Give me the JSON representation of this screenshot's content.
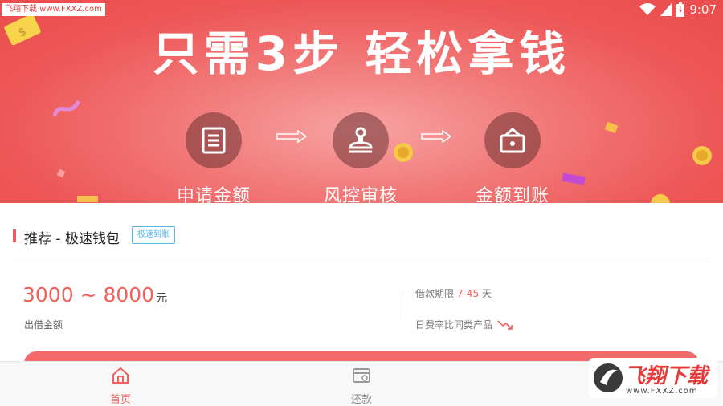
{
  "statusbar": {
    "watermark": "飞翔下载 www.FXXZ.com",
    "time": "9:07"
  },
  "banner": {
    "headline": "只需3步 轻松拿钱",
    "steps": [
      {
        "label": "申请金额",
        "icon": "document-icon"
      },
      {
        "label": "风控审核",
        "icon": "stamp-icon"
      },
      {
        "label": "金额到账",
        "icon": "wallet-icon"
      }
    ]
  },
  "product": {
    "title": "推荐 - 极速钱包",
    "badge": "极速到账",
    "amount_range": "3000 ~ 8000",
    "amount_unit": "元",
    "amount_label": "出借金额",
    "term_label": "借款期限",
    "term_value": "7-45",
    "term_unit": "天",
    "rate_label": "日费率比同类产品"
  },
  "tabbar": {
    "tabs": [
      {
        "label": "首页",
        "icon": "home-icon",
        "active": true
      },
      {
        "label": "还款",
        "icon": "repayment-icon",
        "active": false
      }
    ]
  },
  "watermark_logo": {
    "name": "飞翔下载",
    "url": "www.FXXZ.com"
  },
  "colors": {
    "accent": "#f0605c",
    "banner": "#ee5757",
    "badge": "#55b8e8"
  }
}
